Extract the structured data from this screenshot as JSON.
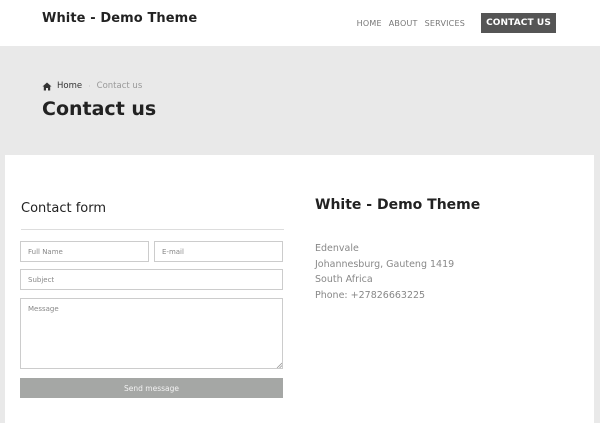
{
  "navbar": {
    "brand": "White - Demo Theme",
    "links": [
      "HOME",
      "ABOUT",
      "SERVICES"
    ],
    "cta": "CONTACT US"
  },
  "header": {
    "breadcrumb": {
      "home": "Home",
      "current": "Contact us"
    },
    "title": "Contact us"
  },
  "form": {
    "title": "Contact form",
    "fullname_placeholder": "Full Name",
    "email_placeholder": "E-mail",
    "subject_placeholder": "Subject",
    "message_placeholder": "Message",
    "submit_label": "Send message"
  },
  "info": {
    "title": "White - Demo Theme",
    "lines": [
      "Edenvale",
      "Johannesburg, Gauteng 1419",
      "South Africa",
      "Phone: +27826663225"
    ]
  },
  "colors": {
    "header_bg": "#e9e9e9",
    "cta_bg": "#555555",
    "button_bg": "#a5a7a5"
  }
}
